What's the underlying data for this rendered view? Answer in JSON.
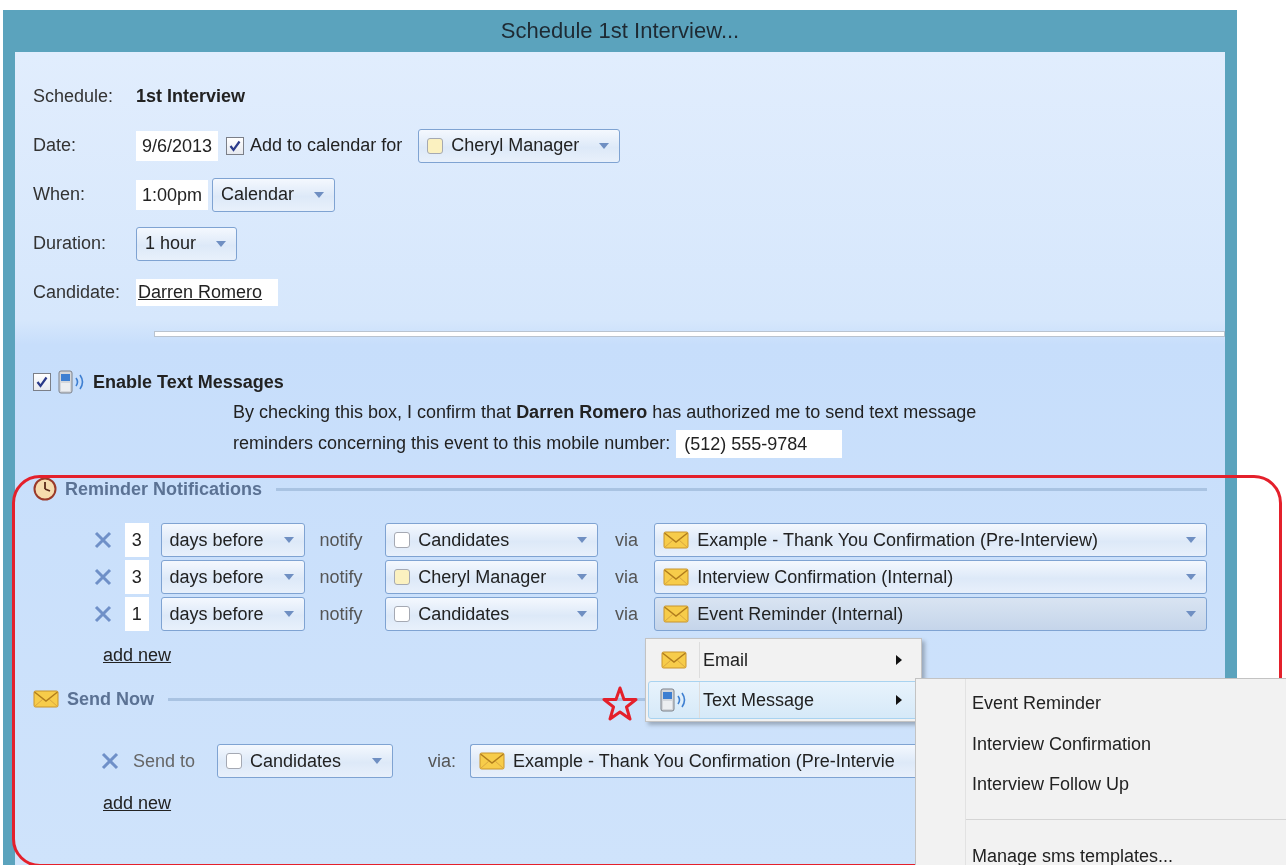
{
  "window": {
    "title": "Schedule 1st Interview..."
  },
  "schedule": {
    "label": "Schedule:",
    "value": "1st Interview"
  },
  "date": {
    "label": "Date:",
    "value": "9/6/2013",
    "add_to_calendar": {
      "label": "Add to calendar for",
      "checked": true
    },
    "calendar_owner": {
      "name": "Cheryl Manager",
      "color": "#fbf1c0"
    }
  },
  "when": {
    "label": "When:",
    "value": "1:00pm",
    "mode": "Calendar"
  },
  "duration": {
    "label": "Duration:",
    "value": "1 hour"
  },
  "candidate": {
    "label": "Candidate:",
    "name": "Darren Romero"
  },
  "text_messages": {
    "checked": true,
    "label": "Enable Text Messages",
    "consent_lines": [
      "By checking this box, I confirm that **Darren Romero** has authorized me to send text message",
      "reminders concerning this event to this mobile number:"
    ],
    "phone": "(512) 555-9784"
  },
  "reminders": {
    "title": "Reminder Notifications",
    "rows": [
      {
        "count": "3",
        "unit": "days before",
        "notify_label": "notify",
        "recipient": {
          "name": "Candidates",
          "color": "#ffffff"
        },
        "via_label": "via",
        "template": "Example - Thank You Confirmation (Pre-Interview)",
        "open": false
      },
      {
        "count": "3",
        "unit": "days before",
        "notify_label": "notify",
        "recipient": {
          "name": "Cheryl Manager",
          "color": "#fbf1c0"
        },
        "via_label": "via",
        "template": "Interview Confirmation (Internal)",
        "open": false
      },
      {
        "count": "1",
        "unit": "days before",
        "notify_label": "notify",
        "recipient": {
          "name": "Candidates",
          "color": "#ffffff"
        },
        "via_label": "via",
        "template": "Event Reminder (Internal)",
        "open": true
      }
    ],
    "add_new": "add new"
  },
  "send_now": {
    "title": "Send Now",
    "rows": [
      {
        "label": "Send to",
        "recipient": {
          "name": "Candidates",
          "color": "#ffffff"
        },
        "via_label": "via:",
        "template": "Example - Thank You Confirmation (Pre-Intervie"
      }
    ],
    "add_new": "add new"
  },
  "context_menu": {
    "items": [
      {
        "kind": "email",
        "label": "Email",
        "selected": false
      },
      {
        "kind": "sms",
        "label": "Text Message",
        "selected": true
      }
    ]
  },
  "submenu": {
    "items": [
      {
        "kind": "item",
        "label": "Event Reminder"
      },
      {
        "kind": "item",
        "label": "Interview Confirmation"
      },
      {
        "kind": "item",
        "label": "Interview Follow Up"
      },
      {
        "kind": "separator"
      },
      {
        "kind": "item",
        "label": "Manage sms templates..."
      }
    ]
  }
}
